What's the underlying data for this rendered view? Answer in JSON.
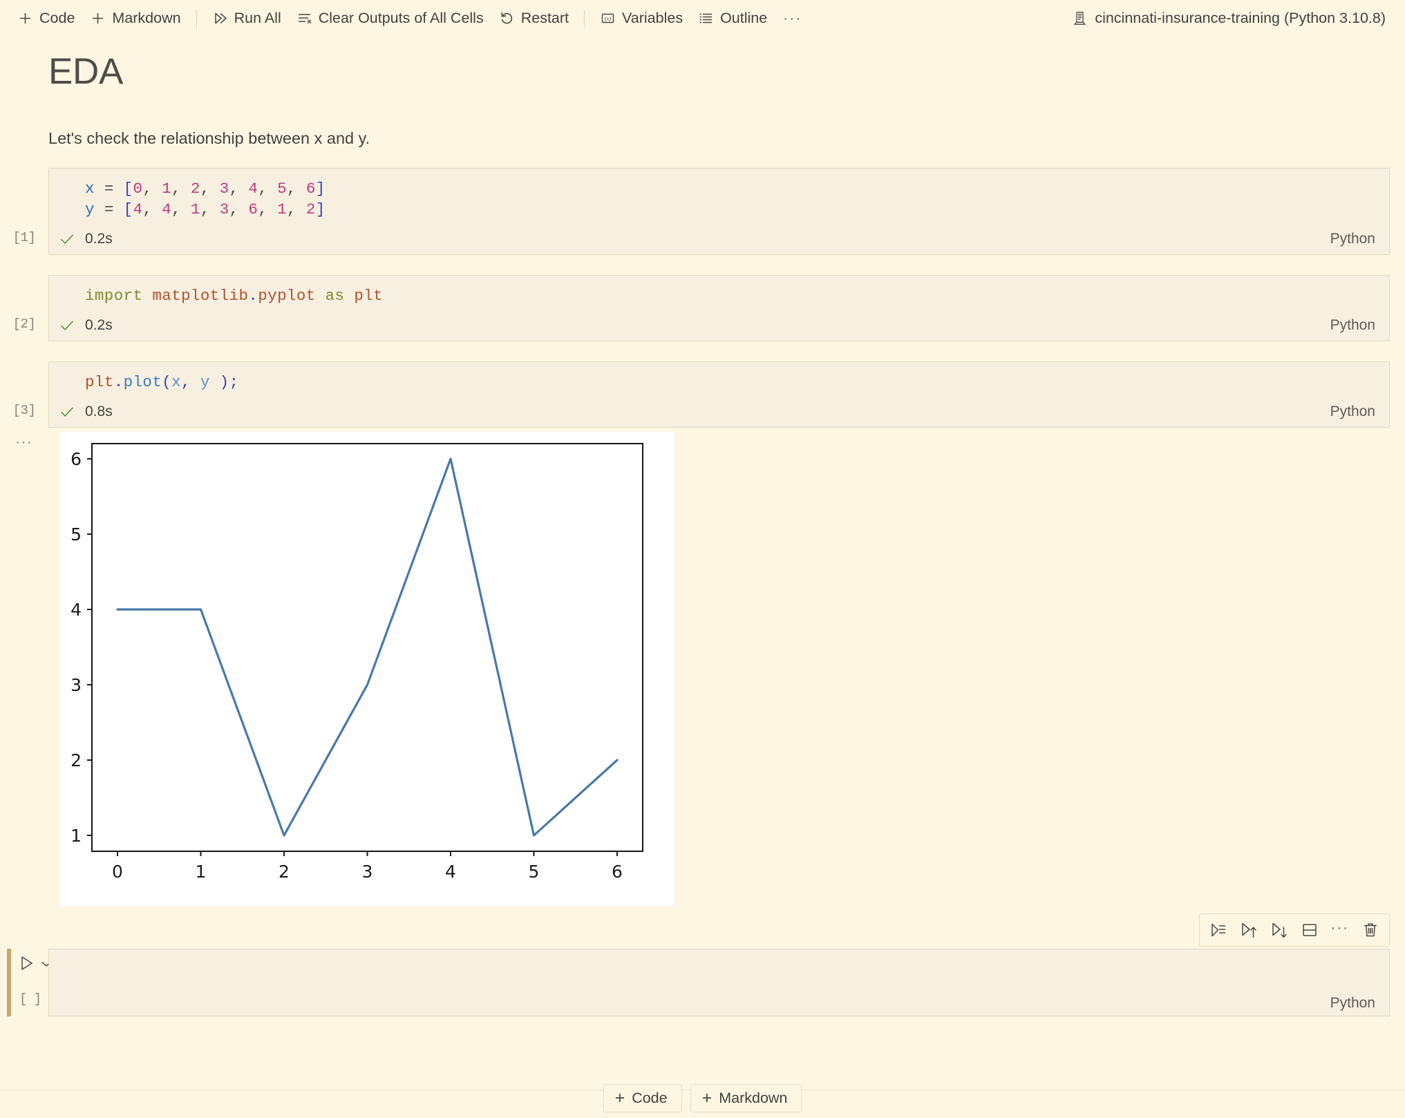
{
  "toolbar": {
    "add_code": "Code",
    "add_markdown": "Markdown",
    "run_all": "Run All",
    "clear_outputs": "Clear Outputs of All Cells",
    "restart": "Restart",
    "variables": "Variables",
    "outline": "Outline",
    "more": "···",
    "kernel": "cincinnati-insurance-training (Python 3.10.8)",
    "icons": {
      "add_code": "plus-icon",
      "add_markdown": "plus-icon",
      "run_all": "run-all-icon",
      "clear_outputs": "clear-outputs-icon",
      "restart": "restart-icon",
      "variables": "variables-icon",
      "outline": "outline-icon",
      "kernel": "kernel-server-icon"
    }
  },
  "markdown": {
    "heading": "EDA",
    "paragraph": "Let's check the relationship between x and y."
  },
  "cells": [
    {
      "exec_count": "[1]",
      "code_plain": "x = [0, 1, 2, 3, 4, 5, 6]\ny = [4, 4, 1, 3, 6, 1, 2]",
      "status_icon": "check-icon",
      "exec_time": "0.2s",
      "language": "Python"
    },
    {
      "exec_count": "[2]",
      "code_plain": "import matplotlib.pyplot as plt",
      "status_icon": "check-icon",
      "exec_time": "0.2s",
      "language": "Python"
    },
    {
      "exec_count": "[3]",
      "code_plain": "plt.plot(x, y );",
      "status_icon": "check-icon",
      "exec_time": "0.8s",
      "language": "Python"
    }
  ],
  "output": {
    "overflow_dots": "···"
  },
  "active_cell": {
    "exec_count": "[ ]",
    "language": "Python",
    "run_icon": "play-icon",
    "chevron_icon": "chevron-down-icon",
    "value": "",
    "placeholder": ""
  },
  "cell_actions": [
    {
      "name": "run-by-line-icon",
      "label": "Run by Line"
    },
    {
      "name": "execute-above-icon",
      "label": "Execute Above Cells"
    },
    {
      "name": "execute-below-icon",
      "label": "Execute Cell and Below"
    },
    {
      "name": "split-cell-icon",
      "label": "Split Cell"
    },
    {
      "name": "more-actions-icon",
      "label": "···"
    },
    {
      "name": "delete-cell-icon",
      "label": "Delete Cell"
    }
  ],
  "add_bar": {
    "code": "Code",
    "markdown": "Markdown"
  },
  "colors": {
    "background": "#fdf6e3",
    "cell_background": "#f7f0e1",
    "cell_border": "#e3dac4",
    "accent_active": "#c9a66b",
    "plot_line": "#4878a8",
    "text": "#44423d",
    "muted_text": "#8a8578",
    "check_green": "#4f8f3a"
  },
  "chart_data": {
    "type": "line",
    "title": "",
    "xlabel": "",
    "ylabel": "",
    "x": [
      0,
      1,
      2,
      3,
      4,
      5,
      6
    ],
    "series": [
      {
        "name": "y",
        "values": [
          4,
          4,
          1,
          3,
          6,
          1,
          2
        ],
        "color": "#4878a8"
      }
    ],
    "xticks": [
      0,
      1,
      2,
      3,
      4,
      5,
      6
    ],
    "yticks": [
      1,
      2,
      3,
      4,
      5,
      6
    ],
    "xlim": [
      -0.3,
      6.3
    ],
    "ylim": [
      0.75,
      6.25
    ],
    "grid": false,
    "legend": false
  }
}
